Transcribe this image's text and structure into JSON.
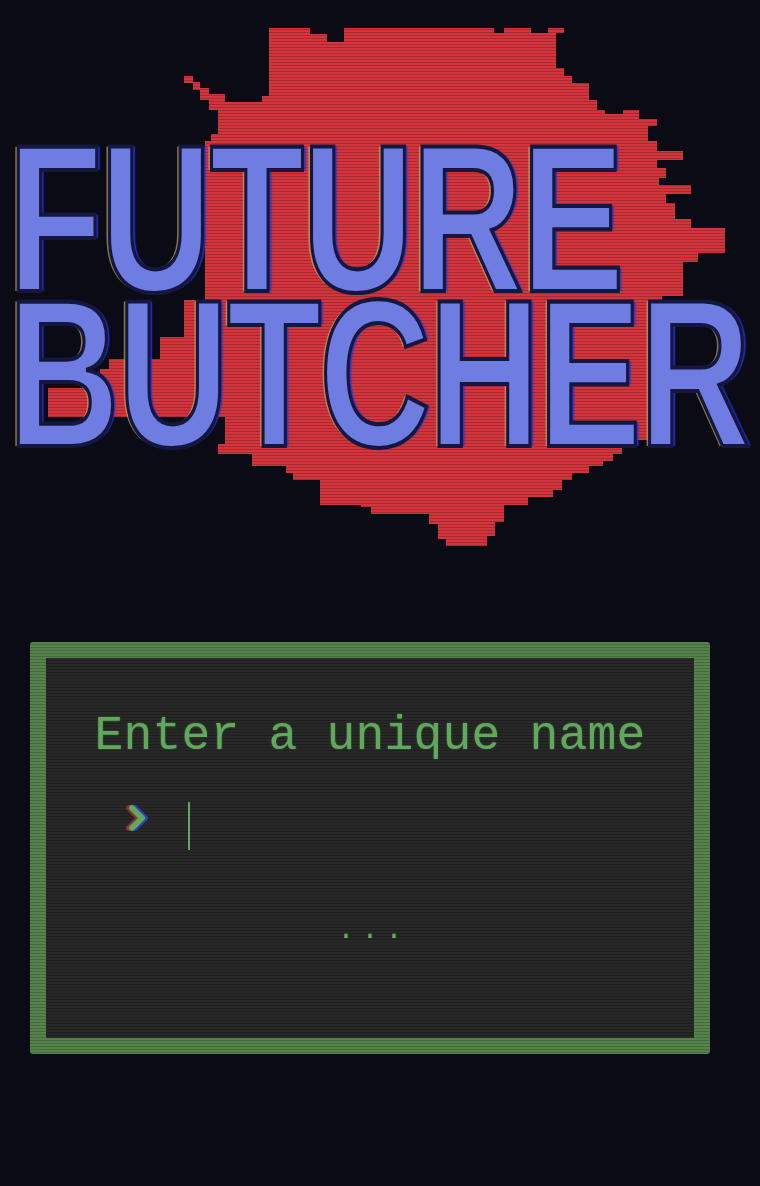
{
  "logo": {
    "lines": [
      "FUTURE",
      "BUTCHER"
    ]
  },
  "prompt": {
    "title": "Enter a unique name",
    "input": {
      "focused": true
    },
    "status": "..."
  }
}
